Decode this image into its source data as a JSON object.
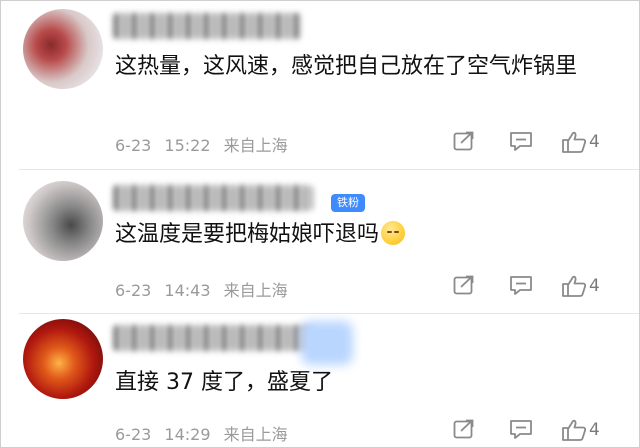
{
  "comments": [
    {
      "text": "这热量，这风速，感觉把自己放在了空气炸锅里",
      "date": "6-23",
      "time": "15:22",
      "location": "来自上海",
      "likes": "4"
    },
    {
      "badge": "铁粉",
      "text": "这温度是要把梅姑娘吓退吗",
      "emoji_icon": "sleepy-face-icon",
      "date": "6-23",
      "time": "14:43",
      "location": "来自上海",
      "likes": "4"
    },
    {
      "text": "直接 37 度了，盛夏了",
      "date": "6-23",
      "time": "14:29",
      "location": "来自上海",
      "likes": "4"
    }
  ],
  "icons": {
    "share": "share-icon",
    "reply": "comment-icon",
    "like": "thumbs-up-icon"
  },
  "colors": {
    "badge": "#3d8bff",
    "meta_text": "#9a9a9a",
    "icon": "#8a8a8a"
  }
}
